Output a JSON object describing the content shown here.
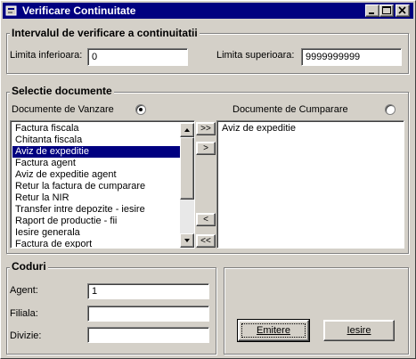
{
  "window": {
    "title": "Verificare Continuitate"
  },
  "interval_group": {
    "title": "Intervalul de verificare a continuitatii",
    "lower_label": "Limita inferioara:",
    "lower_value": "0",
    "upper_label": "Limita superioara:",
    "upper_value": "9999999999"
  },
  "documents_group": {
    "title": "Selectie documente",
    "sales_label": "Documente de Vanzare",
    "sales_selected": true,
    "purchase_label": "Documente de Cumparare",
    "purchase_selected": false,
    "available_items": [
      "Factura fiscala",
      "Chitanta fiscala",
      "Aviz de expeditie",
      "Factura agent",
      "Aviz de expeditie agent",
      "Retur la factura de cumparare",
      "Retur la NIR",
      "Transfer intre depozite - iesire",
      "Raport de productie - fii",
      "Iesire generala",
      "Factura de export"
    ],
    "selected_index": 2,
    "chosen_items": [
      "Aviz de expeditie"
    ],
    "move_all_right": ">>",
    "move_right": ">",
    "move_left": "<",
    "move_all_left": "<<"
  },
  "codes_group": {
    "title": "Coduri",
    "agent_label": "Agent:",
    "agent_value": "1",
    "branch_label": "Filiala:",
    "branch_value": "",
    "division_label": "Divizie:",
    "division_value": ""
  },
  "actions": {
    "emit_label": "Emitere",
    "exit_label": "Iesire"
  },
  "colors": {
    "face": "#d4d0c8",
    "title_bar": "#000080",
    "selection": "#000080"
  }
}
